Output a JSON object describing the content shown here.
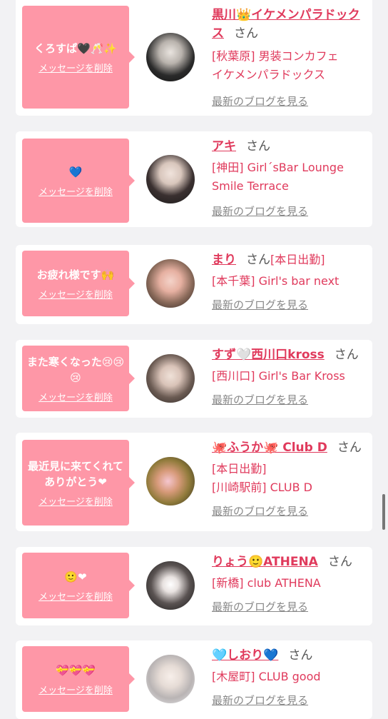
{
  "delete_label": "メッセージを削除",
  "san_label": "さん",
  "blog_label": "最新のブログを見る",
  "cards": [
    {
      "message": "くろすぱ🖤🥂✨",
      "name": "黒川👑イケメンパラドックス",
      "shop_lines": [
        "[秋葉原] 男装コンカフェ",
        "イケメンパラドックス"
      ]
    },
    {
      "message": "💙",
      "name": "アキ",
      "shop_lines": [
        "[神田] Girl´sBar Lounge",
        "Smile Terrace"
      ]
    },
    {
      "message": "お疲れ様です🙌",
      "name": "まり",
      "status": "[本日出勤]",
      "shop_lines": [
        "[本千葉] Girl's bar next"
      ]
    },
    {
      "message": "また寒くなった😢😢😢",
      "name": "すず🤍西川口kross",
      "shop_lines": [
        "[西川口] Girl's Bar Kross"
      ]
    },
    {
      "message": "最近見に来てくれてありがとう❤",
      "name": "🐙ふうか🐙 Club D",
      "shop_lines": [
        "[本日出勤]",
        "[川崎駅前] CLUB D"
      ]
    },
    {
      "message": "🙂❤",
      "name": "りょう🙂ATHENA",
      "shop_lines": [
        "[新橋] club ATHENA"
      ]
    },
    {
      "message": "💝💝💝",
      "name": "🩵しおり💙",
      "shop_lines": [
        "[木屋町] CLUB good"
      ]
    }
  ]
}
